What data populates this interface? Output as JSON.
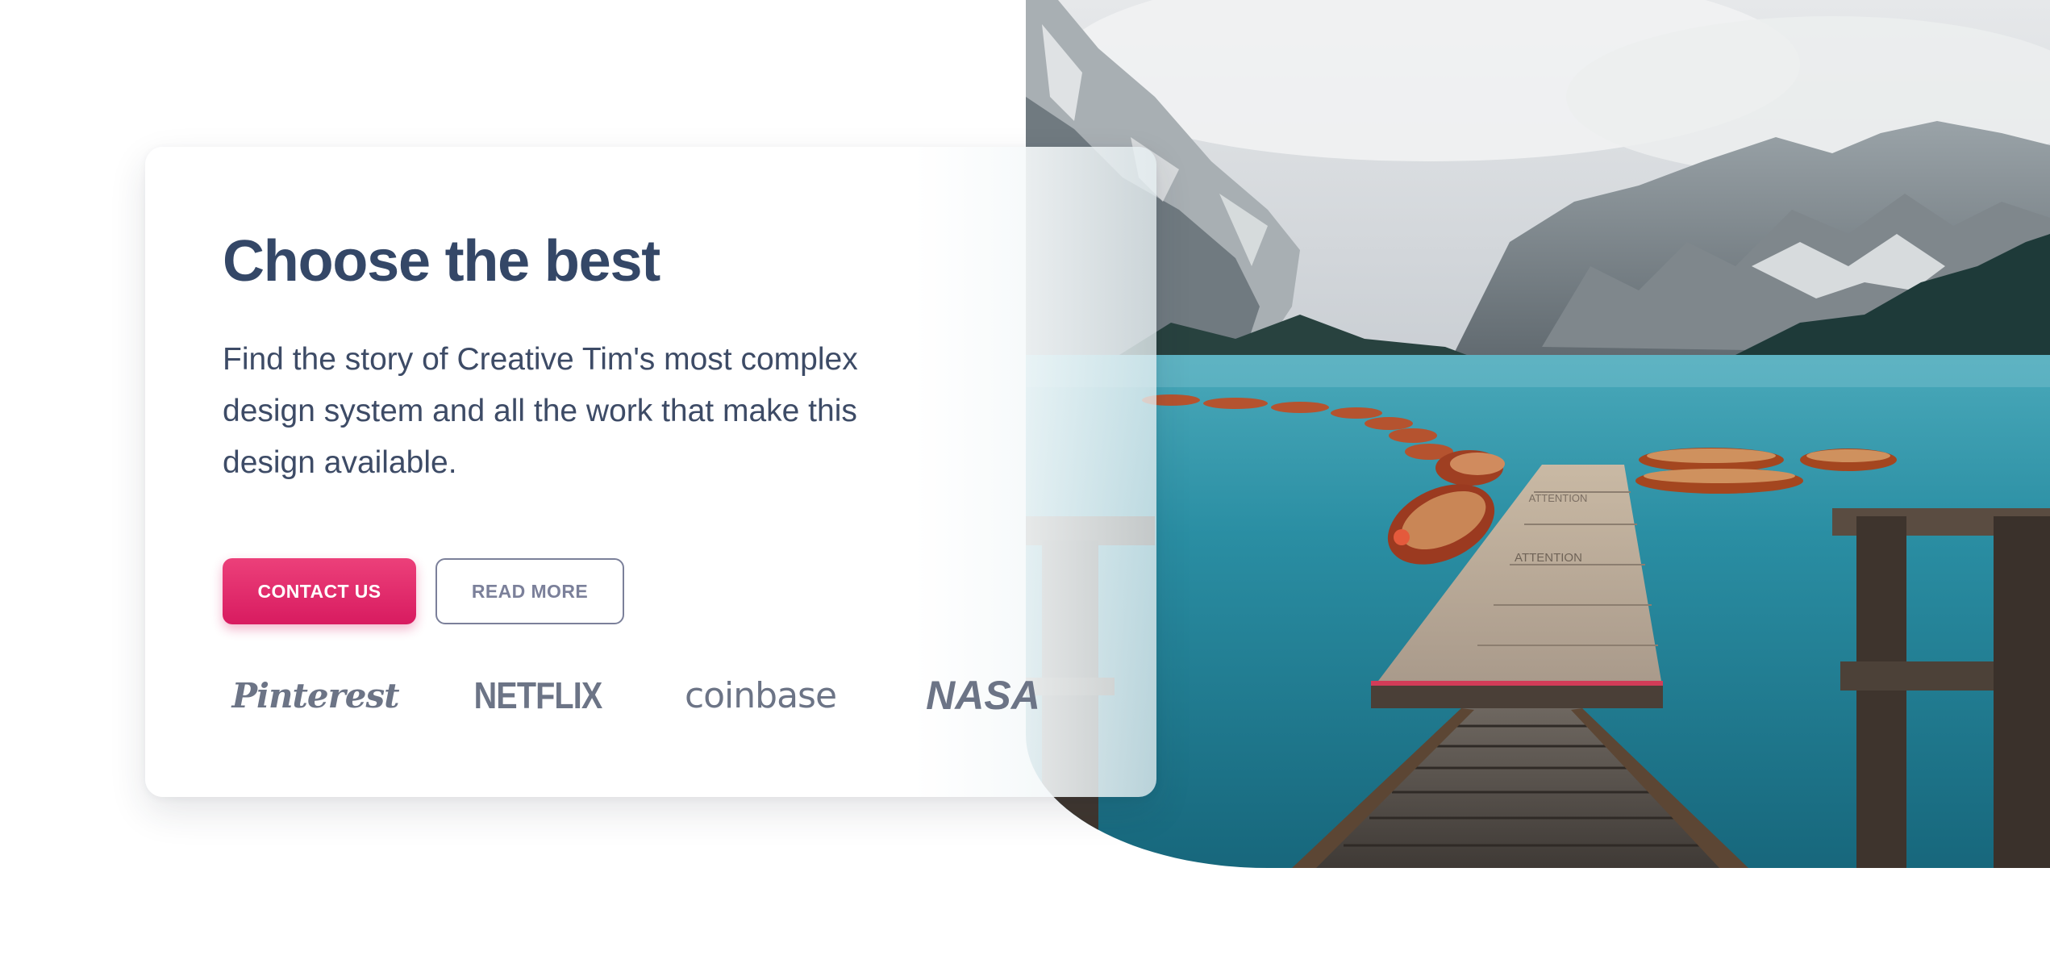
{
  "hero": {
    "title": "Choose the best",
    "description": "Find the story of Creative Tim's most complex design system and all the work that make this design available.",
    "buttons": {
      "contact_label": "CONTACT US",
      "read_more_label": "READ MORE"
    },
    "logos": [
      {
        "name": "Pinterest",
        "icon": "pinterest-logo"
      },
      {
        "name": "NETFLIX",
        "icon": "netflix-logo"
      },
      {
        "name": "coinbase",
        "icon": "coinbase-logo"
      },
      {
        "name": "NASA",
        "icon": "nasa-logo"
      }
    ],
    "image": {
      "subject": "lake-pier-mountains-photo",
      "boat_label": "ATTENTION"
    }
  },
  "colors": {
    "title": "#344767",
    "body_text": "#3d4b66",
    "primary_gradient_start": "#ec407a",
    "primary_gradient_end": "#d81b60",
    "secondary_outline": "#7b809a",
    "logo_gray": "#6c7486",
    "lake": "#1f7f93"
  }
}
